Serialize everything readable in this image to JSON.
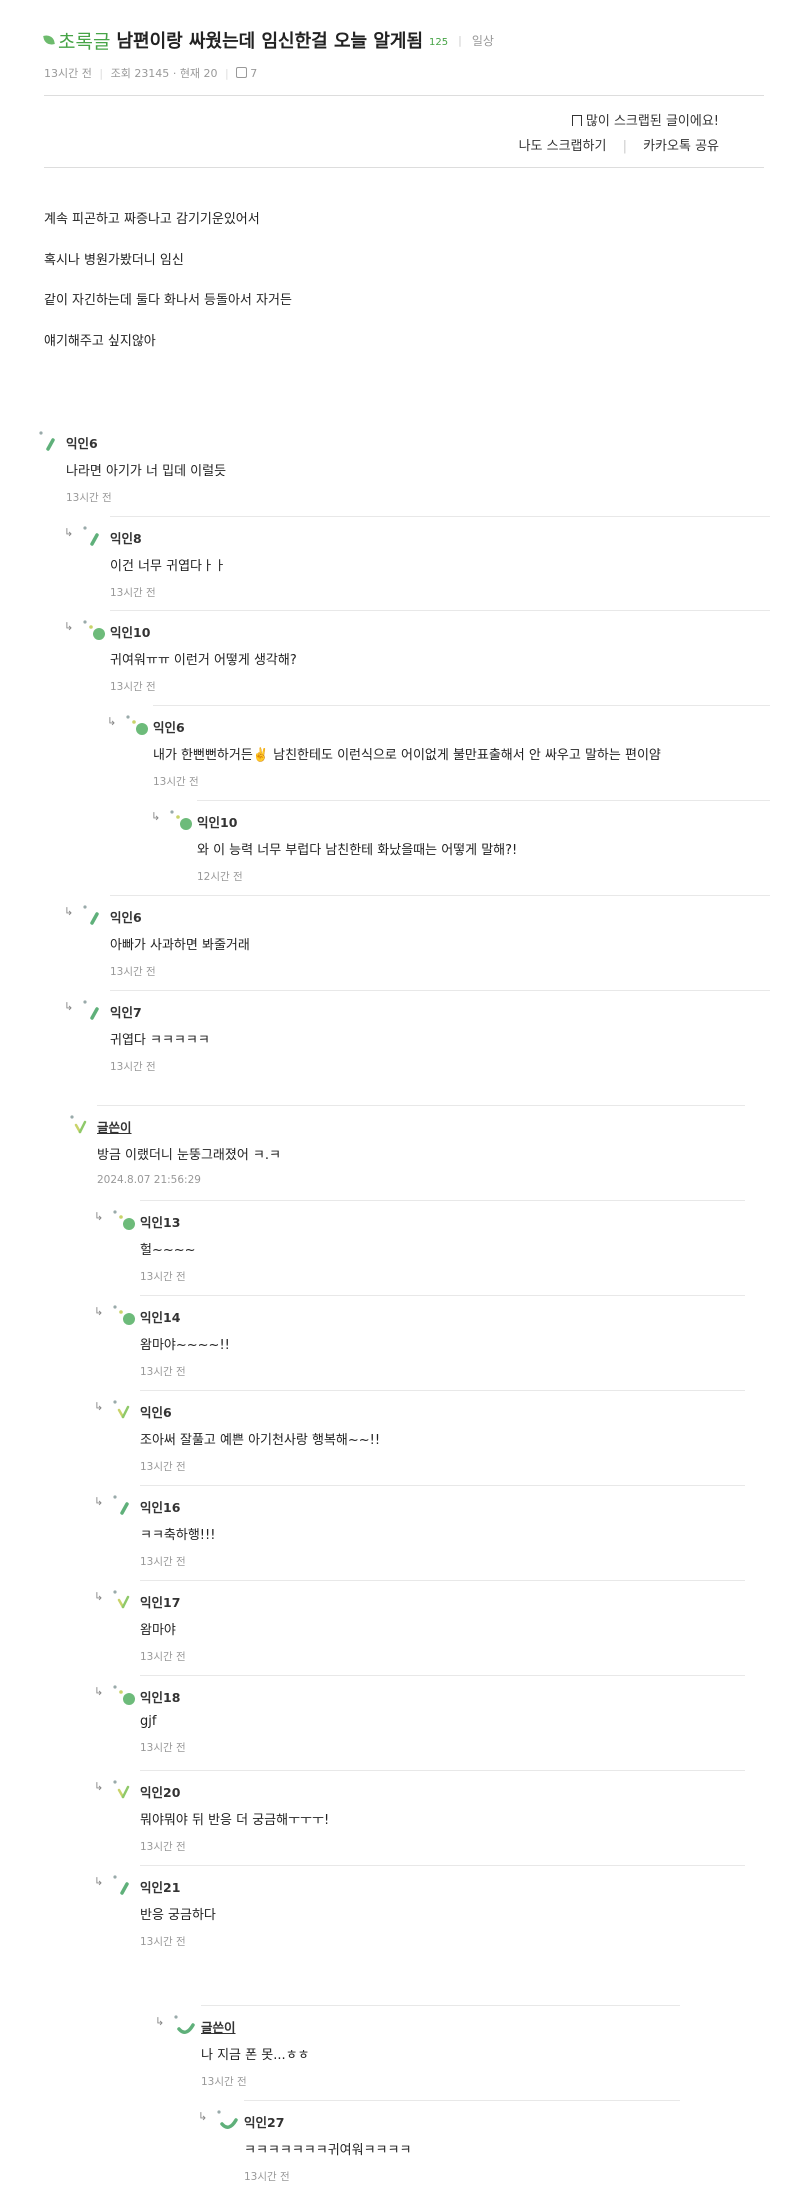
{
  "post": {
    "category": "초록글",
    "title": "남편이랑 싸웠는데 임신한걸 오늘 알게됨",
    "comment_count": "125",
    "tag": "일상",
    "time": "13시간 전",
    "views": "조회 23145",
    "current": "현재 20",
    "likes": "7",
    "scrap_notice": "많이 스크랩된 글이에요!",
    "scrap_button": "나도 스크랩하기",
    "kakao_share": "카카오톡 공유",
    "body": [
      "계속 피곤하고 짜증나고 감기기운있어서",
      "혹시나 병원가봤더니 임신",
      "같이 자긴하는데 둘다 화나서 등돌아서 자거든",
      "얘기해주고 싶지않아"
    ]
  },
  "comments": [
    {
      "nick": "익인6",
      "text": "나라면 아기가 너 밉데 이럴듯",
      "time": "13시간 전"
    },
    {
      "nick": "익인8",
      "text": "이건 너무 귀엽다ㅏㅏ",
      "time": "13시간 전"
    },
    {
      "nick": "익인10",
      "text": "귀여워ㅠㅠ 이런거 어떻게 생각해?",
      "time": "13시간 전"
    },
    {
      "nick": "익인6",
      "text": "내가 한뻔뻔하거든✌️ 남친한테도 이런식으로 어이없게 불만표출해서 안 싸우고 말하는 편이얌",
      "time": "13시간 전"
    },
    {
      "nick": "익인10",
      "text": "와 이 능력 너무 부럽다 남친한테 화났을때는 어떻게 말해?!",
      "time": "12시간 전"
    },
    {
      "nick": "익인6",
      "text": "아빠가 사과하면 봐줄거래",
      "time": "13시간 전"
    },
    {
      "nick": "익인7",
      "text": "귀엽다 ㅋㅋㅋㅋㅋ",
      "time": "13시간 전"
    },
    {
      "nick": "글쓴이",
      "text": "방금 이랬더니 눈뚱그래졌어 ㅋ.ㅋ",
      "time": "2024.8.07 21:56:29"
    },
    {
      "nick": "익인13",
      "text": "헐~~~~",
      "time": "13시간 전"
    },
    {
      "nick": "익인14",
      "text": "왐마야~~~~!!",
      "time": "13시간 전"
    },
    {
      "nick": "익인6",
      "text": "조아써 잘풀고 예쁜 아기천사랑 행복해~~!!",
      "time": "13시간 전"
    },
    {
      "nick": "익인16",
      "text": "ㅋㅋ축하행!!!",
      "time": "13시간 전"
    },
    {
      "nick": "익인17",
      "text": "왐마야",
      "time": "13시간 전"
    },
    {
      "nick": "익인18",
      "text": "gjf",
      "time": "13시간 전"
    },
    {
      "nick": "익인20",
      "text": "뭐야뭐야 뒤 반응 더 궁금해ㅜㅜㅜ!",
      "time": "13시간 전"
    },
    {
      "nick": "익인21",
      "text": "반응 궁금하다",
      "time": "13시간 전"
    },
    {
      "nick": "글쓴이",
      "text": "나 지금 폰 못...ㅎㅎ",
      "time": "13시간 전"
    },
    {
      "nick": "익인27",
      "text": "ㅋㅋㅋㅋㅋㅋㅋ귀여워ㅋㅋㅋㅋ",
      "time": "13시간 전"
    }
  ],
  "colors": {
    "accent": "#47a447",
    "leaf": "#6dbb6d",
    "meta": "#999999"
  },
  "icons": [
    "leaf-icon",
    "thumb-up-icon",
    "bookmark-icon",
    "reply-arrow-icon",
    "avatar-icon"
  ]
}
